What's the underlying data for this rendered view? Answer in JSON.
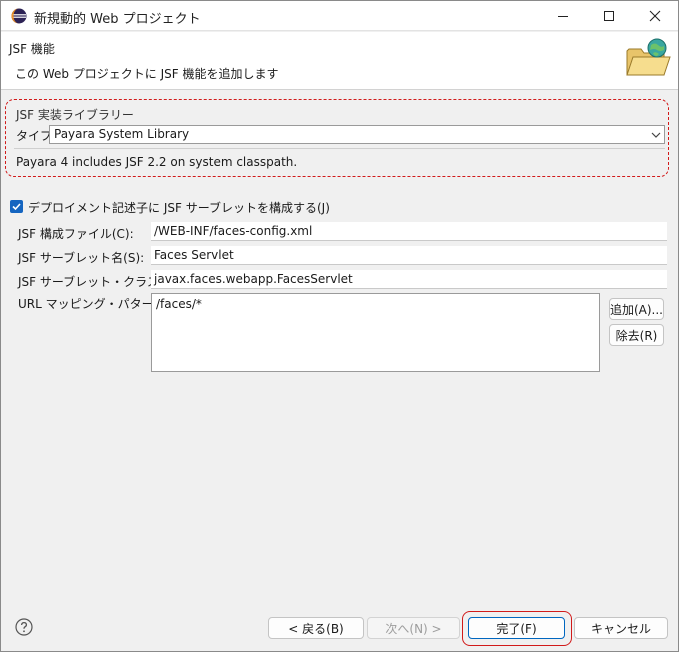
{
  "window": {
    "title": "新規動的 Web プロジェクト"
  },
  "header": {
    "title": "JSF 機能",
    "description": "この Web プロジェクトに JSF 機能を追加します"
  },
  "library": {
    "group_title": "JSF 実装ライブラリー",
    "type_label": "タイプ:",
    "type_value": "Payara System Library",
    "info": "Payara 4 includes JSF 2.2 on system classpath."
  },
  "servlet": {
    "configure_label": "デプロイメント記述子に JSF サーブレットを構成する(J)",
    "configure_checked": true,
    "config_file_label": "JSF 構成ファイル(C):",
    "config_file_value": "/WEB-INF/faces-config.xml",
    "servlet_name_label": "JSF サーブレット名(S):",
    "servlet_name_value": "Faces Servlet",
    "servlet_class_label": "JSF サーブレット・クラス名(L):",
    "servlet_class_value": "javax.faces.webapp.FacesServlet",
    "url_mapping_label": "URL マッピング・パターン(U):",
    "url_mappings": [
      "/faces/*"
    ],
    "add_button": "追加(A)...",
    "remove_button": "除去(R)"
  },
  "footer": {
    "back_button": "< 戻る(B)",
    "next_button": "次へ(N) >",
    "finish_button": "完了(F)",
    "cancel_button": "キャンセル"
  },
  "colors": {
    "accent": "#1565c0",
    "highlight": "#d11a1a"
  },
  "icons": {
    "app": "eclipse-icon",
    "header": "web-project-folder-icon",
    "help": "help-icon"
  }
}
